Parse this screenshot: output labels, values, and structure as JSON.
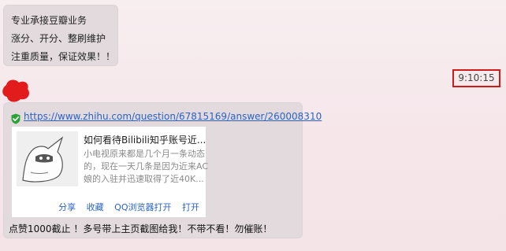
{
  "messages": {
    "ad_lines": [
      "专业承接豆瓣业务",
      "涨分、开分、整刷维护",
      "注重质量，保证效果！！"
    ],
    "timestamp": "9:10:15",
    "link_url": "https://www.zhihu.com/question/67815169/answer/260008310",
    "card": {
      "title": "如何看待Bilibili知乎账号近...",
      "desc_lines": [
        "小电视原来都是几个月一条动态",
        "的，现在一天几条是因为近来AC",
        "娘的入驻并迅速取得了近40K..."
      ],
      "actions": [
        "分享",
        "收藏",
        "QQ浏览器打开",
        "打开"
      ]
    },
    "footer_text": "点赞1000截止 ！多号带上主页截图给我！不带不看！勿催账！"
  },
  "colors": {
    "bubble": "#e3dadd",
    "link": "#2c63c6",
    "highlight": "#d01b1b",
    "verified": "#2aa23a"
  },
  "icons": [
    "verified-check-icon",
    "avatar-blob",
    "bilibili-tv-thumbnail"
  ]
}
